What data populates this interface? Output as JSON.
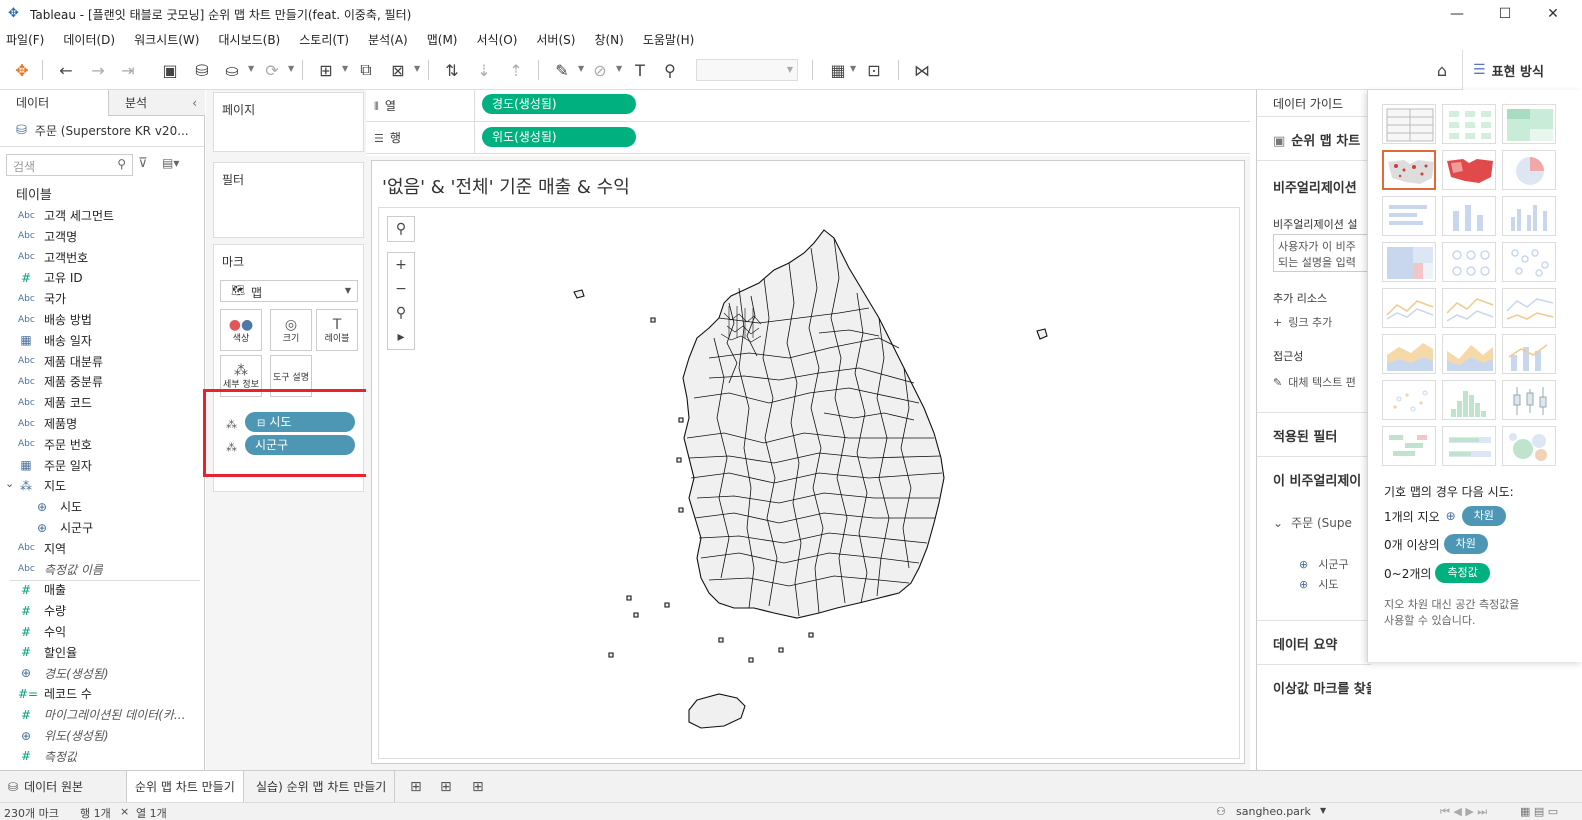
{
  "window": {
    "title": "Tableau - [플랜잇 태블로 굿모닝] 순위 맵 차트 만들기(feat. 이중축, 필터)"
  },
  "menu": [
    "파일(F)",
    "데이터(D)",
    "워크시트(W)",
    "대시보드(B)",
    "스토리(T)",
    "분석(A)",
    "맵(M)",
    "서식(O)",
    "서버(S)",
    "창(N)",
    "도움말(H)"
  ],
  "toolbar": {
    "show_me_label": "표현 방식"
  },
  "data_pane": {
    "tab_data": "데이터",
    "tab_analysis": "분석",
    "datasource": "주문 (Superstore KR v20...",
    "search_placeholder": "검색",
    "tables_header": "테이블",
    "fields": [
      {
        "type": "Abc",
        "label": "고객 세그먼트"
      },
      {
        "type": "Abc",
        "label": "고객명"
      },
      {
        "type": "Abc",
        "label": "고객번호"
      },
      {
        "type": "#",
        "label": "고유 ID"
      },
      {
        "type": "Abc",
        "label": "국가"
      },
      {
        "type": "Abc",
        "label": "배송 방법"
      },
      {
        "type": "date",
        "label": "배송 일자"
      },
      {
        "type": "Abc",
        "label": "제품 대분류"
      },
      {
        "type": "Abc",
        "label": "제품 중분류"
      },
      {
        "type": "Abc",
        "label": "제품 코드"
      },
      {
        "type": "Abc",
        "label": "제품명"
      },
      {
        "type": "Abc",
        "label": "주문 번호"
      },
      {
        "type": "date",
        "label": "주문 일자"
      },
      {
        "type": "hier",
        "label": "지도"
      },
      {
        "type": "geo",
        "label": "시도"
      },
      {
        "type": "geo",
        "label": "시군구"
      },
      {
        "type": "Abc",
        "label": "지역"
      },
      {
        "type": "Abc",
        "label": "측정값 이름"
      },
      {
        "type": "#",
        "label": "매출"
      },
      {
        "type": "#",
        "label": "수량"
      },
      {
        "type": "#",
        "label": "수익"
      },
      {
        "type": "#",
        "label": "할인율"
      },
      {
        "type": "geo",
        "label": "경도(생성됨)"
      },
      {
        "type": "#=",
        "label": "레코드 수"
      },
      {
        "type": "#",
        "label": "마이그레이션된 데이터(카..."
      },
      {
        "type": "geo",
        "label": "위도(생성됨)"
      },
      {
        "type": "#",
        "label": "측정값"
      }
    ]
  },
  "shelves": {
    "pages_label": "페이지",
    "filters_label": "필터",
    "marks_label": "마크",
    "mark_type": "맵",
    "mark_buttons": [
      "색상",
      "크기",
      "레이블",
      "세부 정보",
      "도구 설명"
    ],
    "mark_pills": [
      "시도",
      "시군구"
    ],
    "columns_label": "열",
    "rows_label": "행",
    "columns_pill": "경도(생성됨)",
    "rows_pill": "위도(생성됨)"
  },
  "viz": {
    "title": "'없음' & '전체' 기준 매출 & 수익"
  },
  "guide": {
    "header": "데이터 가이드",
    "sheet_name": "순위 맵 차트",
    "viz_section": "비주얼리제이션",
    "viz_desc_label": "비주얼리제이션 설",
    "desc_line1": "사용자가 이 비주",
    "desc_line2": "되는 설명을 입력",
    "resources_label": "추가 리소스",
    "add_link": "링크 추가",
    "accessibility_label": "접근성",
    "alt_text": "대체 텍스트 편",
    "applied_filters": "적용된 필터",
    "this_viz": "이 비주얼리제이",
    "datasource_short": "주문 (Supe",
    "field_1": "시군구",
    "field_2": "시도",
    "data_summary": "데이터 요약",
    "no_outliers": "이상값 마크를 찾을 수 없음"
  },
  "showme": {
    "hint_title": "기호 맵의 경우 다음 시도:",
    "line1_prefix": "1개의 지오",
    "line1_pill": "차원",
    "line2_prefix": "0개 이상의",
    "line2_pill": "차원",
    "line3_prefix": "0~2개의",
    "line3_pill": "측정값",
    "note_line1": "지오 차원 대신 공간 측정값을",
    "note_line2": "사용할 수 있습니다."
  },
  "tabs": {
    "datasource_tab": "데이터 원본",
    "sheets": [
      "순위 맵 차트 만들기",
      "실습) 순위 맵 차트 만들기"
    ]
  },
  "status": {
    "marks": "230개 마크",
    "rows": "행 1개",
    "cols": "열 1개",
    "user": "sangheo.park"
  },
  "colors": {
    "pill_green": "#00b180",
    "pill_teal": "#4e97b4",
    "highlight_red": "#e8232b",
    "showme_selected": "#e06b3a"
  }
}
